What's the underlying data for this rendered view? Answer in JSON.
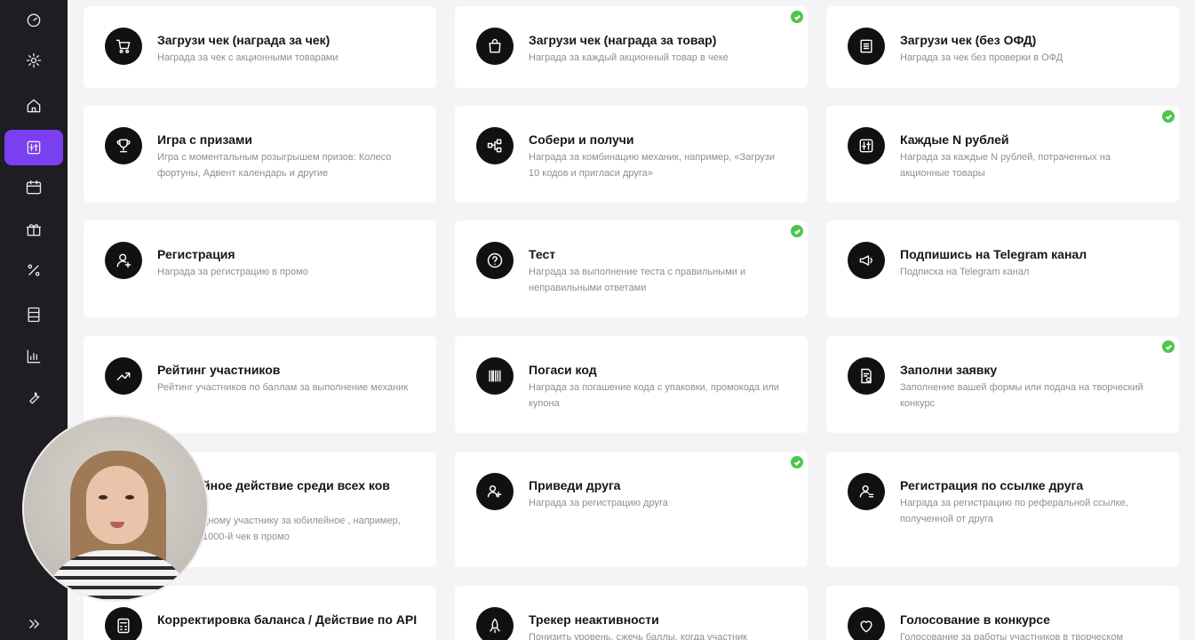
{
  "sidebar": {
    "items": [
      {
        "icon": "dashboard-icon",
        "active": false
      },
      {
        "icon": "gear-icon",
        "active": false
      },
      {
        "icon": "home-icon",
        "active": false
      },
      {
        "icon": "mechanics-icon",
        "active": true
      },
      {
        "icon": "calendar-icon",
        "active": false
      },
      {
        "icon": "gift-icon",
        "active": false
      },
      {
        "icon": "percent-icon",
        "active": false
      },
      {
        "icon": "list-icon",
        "active": false
      },
      {
        "icon": "chart-icon",
        "active": false
      },
      {
        "icon": "wrench-icon",
        "active": false
      }
    ],
    "expand_icon": "double-chevron-right-icon"
  },
  "colors": {
    "accent": "#7b3ff2",
    "check": "#4cc74c",
    "sidebar": "#1d1d22"
  },
  "cards": [
    {
      "icon": "cart-icon",
      "title": "Загрузи чек (награда за чек)",
      "desc": "Награда за чек с акционными товарами",
      "checked": false
    },
    {
      "icon": "bag-icon",
      "title": "Загрузи чек (награда за товар)",
      "desc": "Награда за каждый акционный товар в чеке",
      "checked": true
    },
    {
      "icon": "receipt-icon",
      "title": "Загрузи чек (без ОФД)",
      "desc": "Награда за чек без проверки в ОФД",
      "checked": false
    },
    {
      "icon": "trophy-icon",
      "title": "Игра с призами",
      "desc": "Игра с моментальным розыгрышем призов: Колесо фортуны, Адвент календарь и другие",
      "checked": false
    },
    {
      "icon": "flow-icon",
      "title": "Собери и получи",
      "desc": "Награда за комбинацию механик, например, «Загрузи 10 кодов и пригласи друга»",
      "checked": false
    },
    {
      "icon": "sliders-icon",
      "title": "Каждые N рублей",
      "desc": "Награда за каждые N рублей, потраченных на акционные товары",
      "checked": true
    },
    {
      "icon": "user-plus-icon",
      "title": "Регистрация",
      "desc": "Награда за регистрацию в промо",
      "checked": false
    },
    {
      "icon": "question-icon",
      "title": "Тест",
      "desc": "Награда за выполнение теста с правильными и неправильными ответами",
      "checked": true
    },
    {
      "icon": "megaphone-icon",
      "title": "Подпишись на Telegram канал",
      "desc": "Подписка на Telegram канал",
      "checked": false
    },
    {
      "icon": "trend-icon",
      "title": "Рейтинг участников",
      "desc": "Рейтинг участников по баллам за выполнение механик",
      "checked": false
    },
    {
      "icon": "barcode-icon",
      "title": "Погаси код",
      "desc": "Награда за погашение кода с упаковки, промокода или купона",
      "checked": false
    },
    {
      "icon": "form-icon",
      "title": "Заполни заявку",
      "desc": "Заполнение вашей формы или подача на творческий конкурс",
      "checked": true
    },
    {
      "icon": "star-icon",
      "title": "йное действие среди всех ков",
      "desc": "дному участнику за юбилейное , например, 1000-й чек в промо",
      "checked": false
    },
    {
      "icon": "friends-icon",
      "title": "Приведи друга",
      "desc": "Награда за регистрацию друга",
      "checked": true
    },
    {
      "icon": "user-link-icon",
      "title": "Регистрация по ссылке друга",
      "desc": "Награда за регистрацию по реферальной ссылке, полученной от друга",
      "checked": false
    },
    {
      "icon": "calculator-icon",
      "title": "Корректировка баланса / Действие по API",
      "desc": "",
      "checked": false
    },
    {
      "icon": "rocket-icon",
      "title": "Трекер неактивности",
      "desc": "Понизить уровень, сжечь баллы, когда участник",
      "checked": false
    },
    {
      "icon": "heart-icon",
      "title": "Голосование в конкурсе",
      "desc": "Голосование за работы участников в творческом",
      "checked": false
    }
  ]
}
